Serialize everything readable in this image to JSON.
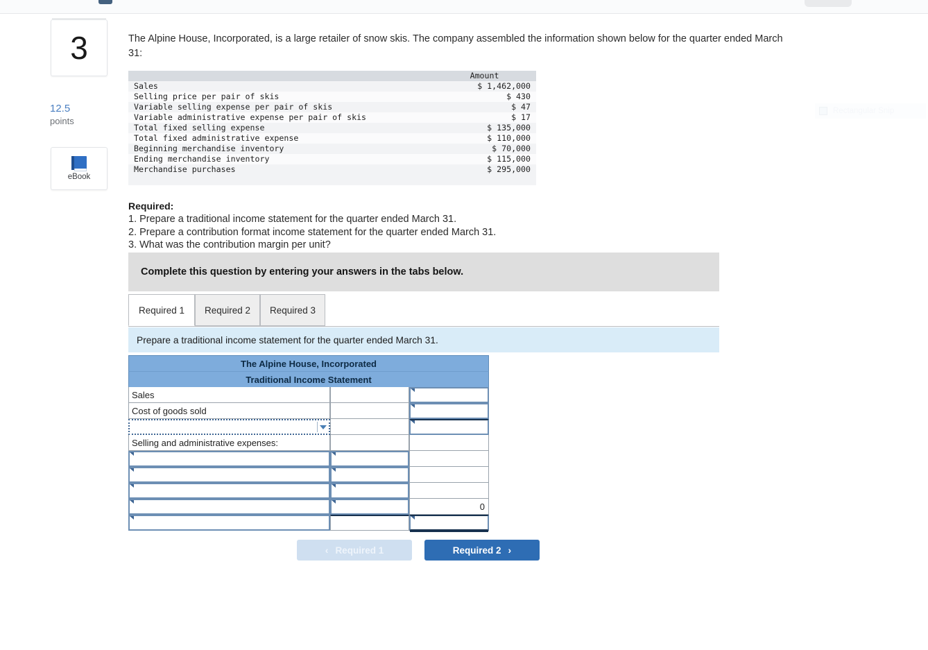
{
  "sidebar": {
    "question_number": "3",
    "points_value": "12.5",
    "points_label": "points",
    "ebook_label": "eBook"
  },
  "main": {
    "intro": "The Alpine House, Incorporated, is a large retailer of snow skis. The company assembled the information shown below for the quarter ended March 31:",
    "data_table": {
      "header_label": "",
      "header_amount": "Amount",
      "rows": [
        {
          "label": "Sales",
          "amount": "$ 1,462,000"
        },
        {
          "label": "Selling price per pair of skis",
          "amount": "$ 430"
        },
        {
          "label": "Variable selling expense per pair of skis",
          "amount": "$ 47"
        },
        {
          "label": "Variable administrative expense per pair of skis",
          "amount": "$ 17"
        },
        {
          "label": "Total fixed selling expense",
          "amount": "$ 135,000"
        },
        {
          "label": "Total fixed administrative expense",
          "amount": "$ 110,000"
        },
        {
          "label": "Beginning merchandise inventory",
          "amount": "$ 70,000"
        },
        {
          "label": "Ending merchandise inventory",
          "amount": "$ 115,000"
        },
        {
          "label": "Merchandise purchases",
          "amount": "$ 295,000"
        }
      ]
    },
    "required": {
      "heading": "Required:",
      "items": [
        "1. Prepare a traditional income statement for the quarter ended March 31.",
        "2. Prepare a contribution format income statement for the quarter ended March 31.",
        "3. What was the contribution margin per unit?"
      ]
    },
    "complete_banner": "Complete this question by entering your answers in the tabs below.",
    "tabs": [
      {
        "label": "Required 1",
        "active": true
      },
      {
        "label": "Required 2",
        "active": false
      },
      {
        "label": "Required 3",
        "active": false
      }
    ],
    "instruction": "Prepare a traditional income statement for the quarter ended March 31.",
    "answer_grid": {
      "title_line1": "The Alpine House, Incorporated",
      "title_line2": "Traditional Income Statement",
      "rows": [
        {
          "label": "Sales",
          "mid": "",
          "right": ""
        },
        {
          "label": "Cost of goods sold",
          "mid": "",
          "right": ""
        },
        {
          "label": "",
          "mid": "",
          "right": ""
        },
        {
          "label": "Selling and administrative expenses:",
          "mid": "",
          "right": ""
        },
        {
          "label": "",
          "mid": "",
          "right": ""
        },
        {
          "label": "",
          "mid": "",
          "right": ""
        },
        {
          "label": "",
          "mid": "",
          "right": ""
        },
        {
          "label": "",
          "mid": "",
          "right": "0"
        },
        {
          "label": "",
          "mid": "",
          "right": ""
        }
      ]
    },
    "nav": {
      "prev_label": "Required 1",
      "prev_chevron": "‹",
      "next_label": "Required 2",
      "next_chevron": "›"
    }
  },
  "overlay": {
    "snip_label": "Rectangular Snip"
  },
  "colors": {
    "grid_header_blue": "#7eacdc",
    "instruction_blue": "#d9ecf8",
    "banner_grey": "#dedede",
    "next_button_blue": "#2e6db4",
    "prev_button_blue": "#cfdff0",
    "points_blue": "#4a7fc1"
  }
}
